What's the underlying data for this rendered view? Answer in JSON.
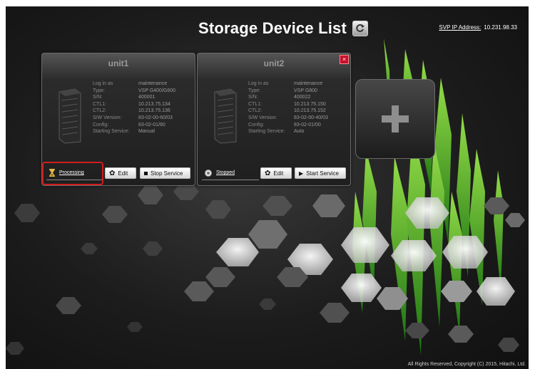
{
  "page": {
    "title": "Storage Device List",
    "svp_label": "SVP IP Address:",
    "svp_ip": "10.231.98.33",
    "copyright": "All Rights Reserved, Copyright (C) 2015, Hitachi, Ltd."
  },
  "info_labels": {
    "login": "Log in as",
    "type": "Type:",
    "sn": "S/N:",
    "ctl1": "CTL1:",
    "ctl2": "CTL2:",
    "sw": "S/W Version:",
    "config": "Config:",
    "starting": "Starting Service:"
  },
  "cards": [
    {
      "name": "unit1",
      "login": "maintenance",
      "type": "VSP G400/G600",
      "sn": "400001",
      "ctl1": "10.213.75.134",
      "ctl2": "10.213.75.136",
      "sw": "83-02-00-60/03",
      "config": "83-02-01/60",
      "starting": "Manual",
      "status": "Processing",
      "edit": "Edit",
      "service_btn": "Stop Service"
    },
    {
      "name": "unit2",
      "login": "maintenance",
      "type": "VSP G800",
      "sn": "400022",
      "ctl1": "10.213.75.150",
      "ctl2": "10.213.75.152",
      "sw": "83-02-00-40/03",
      "config": "83-02-01/00",
      "starting": "Auto",
      "status": "Stopped",
      "edit": "Edit",
      "service_btn": "Start Service",
      "close": "×"
    }
  ],
  "colors": {
    "highlight": "#d21c1c",
    "accent_green": "#7ed321",
    "close_red": "#c8102e"
  },
  "icons": [
    "refresh-icon",
    "server-icon",
    "hourglass-icon",
    "gear-icon",
    "stop-icon",
    "play-icon",
    "stopped-icon",
    "close-icon",
    "plus-icon"
  ]
}
